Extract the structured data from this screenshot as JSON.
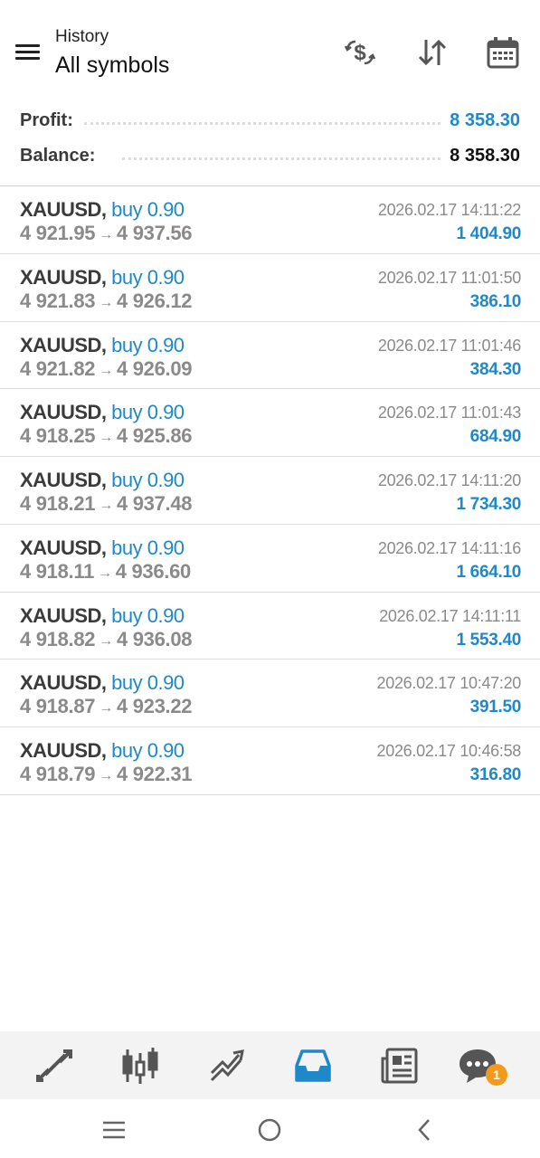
{
  "header": {
    "subtitle": "History",
    "title": "All symbols",
    "icons": [
      "menu-icon",
      "dollar-exchange-icon",
      "sort-icon",
      "calendar-icon"
    ]
  },
  "summary": {
    "profit_label": "Profit:",
    "profit_value": "8 358.30",
    "balance_label": "Balance:",
    "balance_value": "8 358.30"
  },
  "deals": [
    {
      "symbol": "XAUUSD,",
      "side": "buy 0.90",
      "open": "4 921.95",
      "arrow": "→",
      "close": "4 937.56",
      "time": "2026.02.17 14:11:22",
      "profit": "1 404.90"
    },
    {
      "symbol": "XAUUSD,",
      "side": "buy 0.90",
      "open": "4 921.83",
      "arrow": "→",
      "close": "4 926.12",
      "time": "2026.02.17 11:01:50",
      "profit": "386.10"
    },
    {
      "symbol": "XAUUSD,",
      "side": "buy 0.90",
      "open": "4 921.82",
      "arrow": "→",
      "close": "4 926.09",
      "time": "2026.02.17 11:01:46",
      "profit": "384.30"
    },
    {
      "symbol": "XAUUSD,",
      "side": "buy 0.90",
      "open": "4 918.25",
      "arrow": "→",
      "close": "4 925.86",
      "time": "2026.02.17 11:01:43",
      "profit": "684.90"
    },
    {
      "symbol": "XAUUSD,",
      "side": "buy 0.90",
      "open": "4 918.21",
      "arrow": "→",
      "close": "4 937.48",
      "time": "2026.02.17 14:11:20",
      "profit": "1 734.30"
    },
    {
      "symbol": "XAUUSD,",
      "side": "buy 0.90",
      "open": "4 918.11",
      "arrow": "→",
      "close": "4 936.60",
      "time": "2026.02.17 14:11:16",
      "profit": "1 664.10"
    },
    {
      "symbol": "XAUUSD,",
      "side": "buy 0.90",
      "open": "4 918.82",
      "arrow": "→",
      "close": "4 936.08",
      "time": "2026.02.17 14:11:11",
      "profit": "1 553.40"
    },
    {
      "symbol": "XAUUSD,",
      "side": "buy 0.90",
      "open": "4 918.87",
      "arrow": "→",
      "close": "4 923.22",
      "time": "2026.02.17 10:47:20",
      "profit": "391.50"
    },
    {
      "symbol": "XAUUSD,",
      "side": "buy 0.90",
      "open": "4 918.79",
      "arrow": "→",
      "close": "4 922.31",
      "time": "2026.02.17 10:46:58",
      "profit": "316.80"
    }
  ],
  "tabbar": {
    "tabs": [
      "quotes-icon",
      "chart-icon",
      "trade-icon",
      "history-icon",
      "news-icon",
      "chat-icon"
    ],
    "active": "history-icon",
    "chat_badge": "1"
  },
  "colors": {
    "accent": "#1e88c9",
    "badge": "#f29a1c",
    "muted": "#8a8a8a",
    "icon": "#555555"
  },
  "system_nav": [
    "recent-apps-icon",
    "home-icon",
    "back-icon"
  ]
}
